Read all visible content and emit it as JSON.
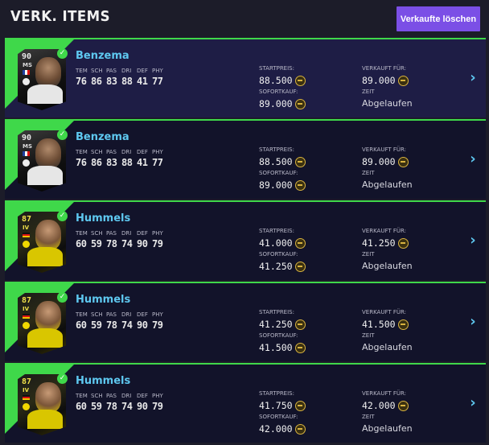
{
  "header": {
    "title": "VERK. ITEMS",
    "clear_button": "Verkaufte löschen",
    "accent": "#7b4fe6"
  },
  "status_color": "#3fd84a",
  "name_color": "#5ec8f0",
  "stat_labels": [
    "TEM",
    "SCH",
    "PAS",
    "DRI",
    "DEF",
    "PHY"
  ],
  "price_labels": {
    "start": "STARTPREIS:",
    "buy_now": "SOFORTKAUF:",
    "sold_for": "VERKAUFT FÜR:",
    "time": "ZEIT"
  },
  "items": [
    {
      "name": "Benzema",
      "rating": "90",
      "position": "MS",
      "card_style": "silver",
      "nation": "fr",
      "stats": [
        "76",
        "86",
        "83",
        "88",
        "41",
        "77"
      ],
      "start_price": "88.500",
      "buy_now": "89.000",
      "sold_for": "89.000",
      "time": "Abgelaufen",
      "selected": true
    },
    {
      "name": "Benzema",
      "rating": "90",
      "position": "MS",
      "card_style": "silver",
      "nation": "fr",
      "stats": [
        "76",
        "86",
        "83",
        "88",
        "41",
        "77"
      ],
      "start_price": "88.500",
      "buy_now": "89.000",
      "sold_for": "89.000",
      "time": "Abgelaufen",
      "selected": false
    },
    {
      "name": "Hummels",
      "rating": "87",
      "position": "IV",
      "card_style": "gold",
      "nation": "de",
      "stats": [
        "60",
        "59",
        "78",
        "74",
        "90",
        "79"
      ],
      "start_price": "41.000",
      "buy_now": "41.250",
      "sold_for": "41.250",
      "time": "Abgelaufen",
      "selected": false
    },
    {
      "name": "Hummels",
      "rating": "87",
      "position": "IV",
      "card_style": "gold",
      "nation": "de",
      "stats": [
        "60",
        "59",
        "78",
        "74",
        "90",
        "79"
      ],
      "start_price": "41.250",
      "buy_now": "41.500",
      "sold_for": "41.500",
      "time": "Abgelaufen",
      "selected": false
    },
    {
      "name": "Hummels",
      "rating": "87",
      "position": "IV",
      "card_style": "gold",
      "nation": "de",
      "stats": [
        "60",
        "59",
        "78",
        "74",
        "90",
        "79"
      ],
      "start_price": "41.750",
      "buy_now": "42.000",
      "sold_for": "42.000",
      "time": "Abgelaufen",
      "selected": false
    }
  ]
}
